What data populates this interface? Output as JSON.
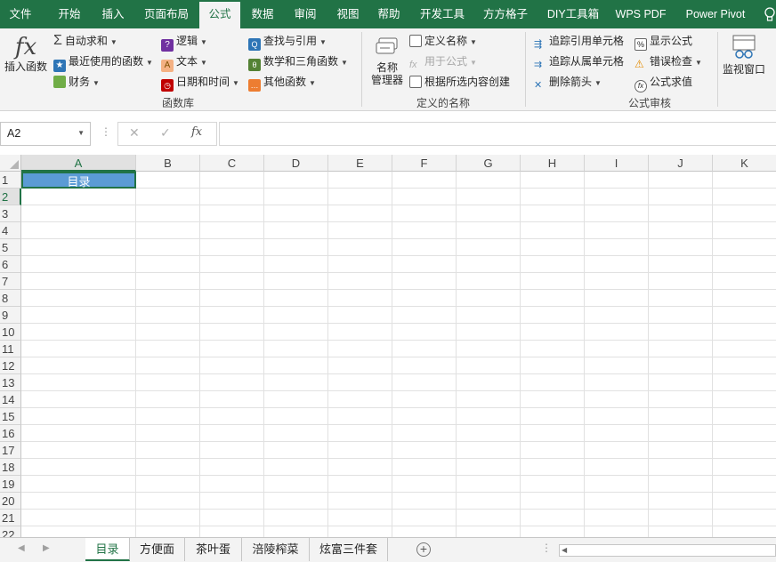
{
  "menu": {
    "tabs": [
      "文件",
      "开始",
      "插入",
      "页面布局",
      "公式",
      "数据",
      "审阅",
      "视图",
      "帮助",
      "开发工具",
      "方方格子",
      "DIY工具箱",
      "WPS PDF",
      "Power Pivot"
    ],
    "active": "公式"
  },
  "ribbon": {
    "function_library": {
      "insert_function": "插入函数",
      "autosum": "自动求和",
      "recent": "最近使用的函数",
      "financial": "财务",
      "logical": "逻辑",
      "text": "文本",
      "datetime": "日期和时间",
      "lookup": "查找与引用",
      "math": "数学和三角函数",
      "other": "其他函数",
      "label": "函数库"
    },
    "defined_names": {
      "name_manager_line1": "名称",
      "name_manager_line2": "管理器",
      "define_name": "定义名称",
      "use_in_formula": "用于公式",
      "create_from_selection": "根据所选内容创建",
      "label": "定义的名称"
    },
    "formula_auditing": {
      "trace_precedents": "追踪引用单元格",
      "trace_dependents": "追踪从属单元格",
      "remove_arrows": "删除箭头",
      "show_formulas": "显示公式",
      "error_checking": "错误检查",
      "evaluate_formula": "公式求值",
      "label": "公式审核"
    },
    "watch_window": "监视窗口"
  },
  "formula_bar": {
    "name_box": "A2",
    "cancel": "✕",
    "enter": "✓",
    "fx": "fx",
    "content": ""
  },
  "grid": {
    "columns": [
      "A",
      "B",
      "C",
      "D",
      "E",
      "F",
      "G",
      "H",
      "I",
      "J",
      "K"
    ],
    "selected_column": "A",
    "rows": [
      "1",
      "2",
      "3",
      "4",
      "5",
      "6",
      "7",
      "8",
      "9",
      "10",
      "11",
      "12",
      "13",
      "14",
      "15",
      "16",
      "17",
      "18",
      "19",
      "20",
      "21",
      "22"
    ],
    "selected_row": "2",
    "cell_a1": "目录",
    "cell_a1_fill": "#5b9bd5"
  },
  "sheets": {
    "tabs": [
      "目录",
      "方便面",
      "茶叶蛋",
      "涪陵榨菜",
      "炫富三件套"
    ],
    "active": "目录",
    "add": "+"
  },
  "colors": {
    "accent": "#217346",
    "ribbon_bg": "#f3f3f3"
  }
}
